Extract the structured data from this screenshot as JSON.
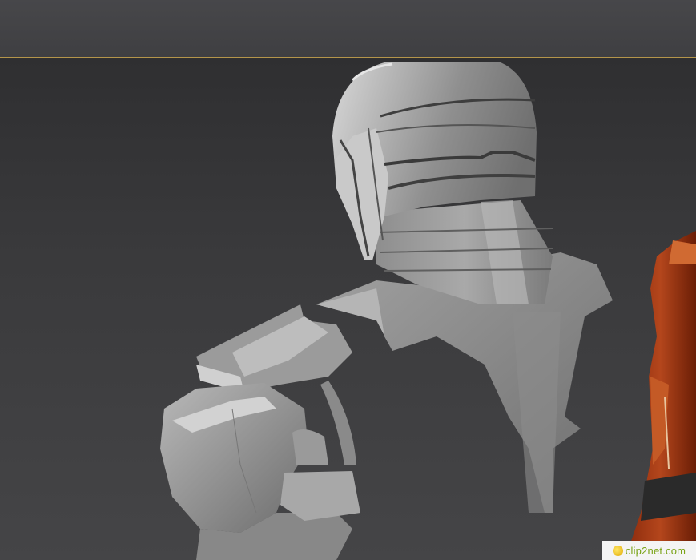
{
  "viewport": {
    "background_color": "#3a3a3c",
    "accent_line_color": "#b4954a"
  },
  "watermark": {
    "text": "clip2net.com"
  }
}
